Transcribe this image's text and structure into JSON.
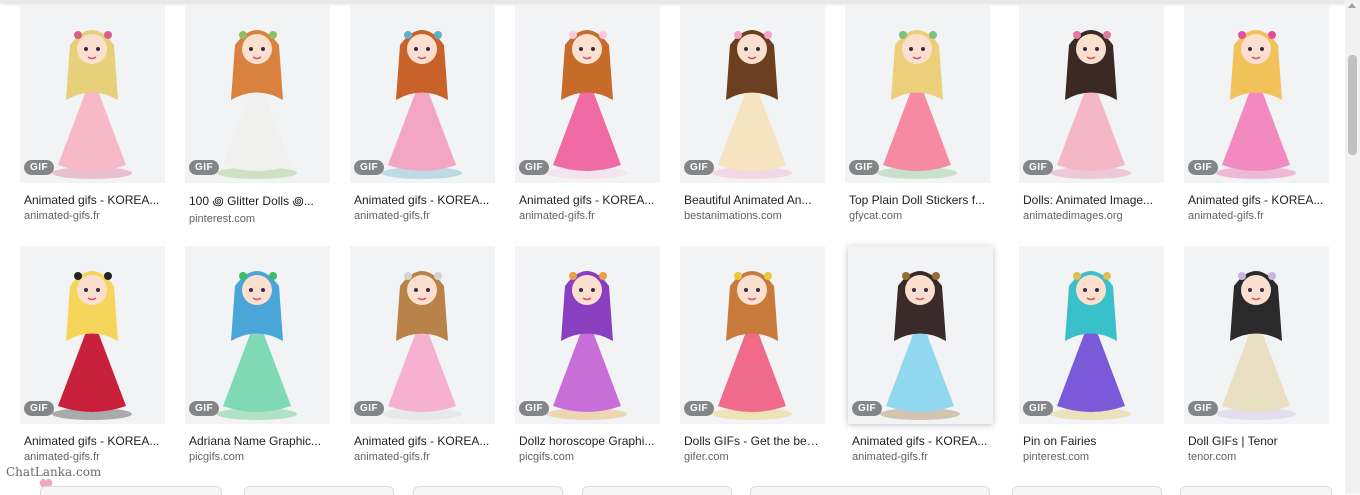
{
  "badge_label": "GIF",
  "watermark": "ChatLanka.com",
  "results": [
    {
      "title": "Animated gifs - KOREA...",
      "source": "animated-gifs.fr",
      "icon": "doll-fairy-tree-image"
    },
    {
      "title": "100 ꩜ Glitter Dolls ꩜...",
      "source": "pinterest.com",
      "icon": "doll-white-gown-image"
    },
    {
      "title": "Animated gifs - KOREA...",
      "source": "animated-gifs.fr",
      "icon": "doll-harp-image"
    },
    {
      "title": "Animated gifs - KOREA...",
      "source": "animated-gifs.fr",
      "icon": "doll-pink-curly-image"
    },
    {
      "title": "Beautiful Animated An...",
      "source": "bestanimations.com",
      "icon": "doll-angel-image"
    },
    {
      "title": "Top Plain Doll Stickers f...",
      "source": "gfycat.com",
      "icon": "doll-blonde-bench-image"
    },
    {
      "title": "Dolls: Animated Image...",
      "source": "animatedimages.org",
      "icon": "doll-umbrella-gown-image"
    },
    {
      "title": "Animated gifs - KOREA...",
      "source": "animated-gifs.fr",
      "icon": "doll-lamp-chair-image"
    },
    {
      "title": "Animated gifs - KOREA...",
      "source": "animated-gifs.fr",
      "icon": "doll-red-dress-image"
    },
    {
      "title": "Adriana Name Graphic...",
      "source": "picgifs.com",
      "icon": "doll-blue-hair-image"
    },
    {
      "title": "Animated gifs - KOREA...",
      "source": "animated-gifs.fr",
      "icon": "doll-table-image"
    },
    {
      "title": "Dollz horoscope Graphi...",
      "source": "picgifs.com",
      "icon": "doll-purple-zodiac-image"
    },
    {
      "title": "Dolls GIFs - Get the bes...",
      "source": "gifer.com",
      "icon": "doll-couple-image"
    },
    {
      "title": "Animated gifs - KOREA...",
      "source": "animated-gifs.fr",
      "icon": "doll-swing-image"
    },
    {
      "title": "Pin on Fairies",
      "source": "pinterest.com",
      "icon": "doll-fairy-wings-image"
    },
    {
      "title": "Doll GIFs | Tenor",
      "source": "tenor.com",
      "icon": "doll-parasol-image"
    }
  ]
}
